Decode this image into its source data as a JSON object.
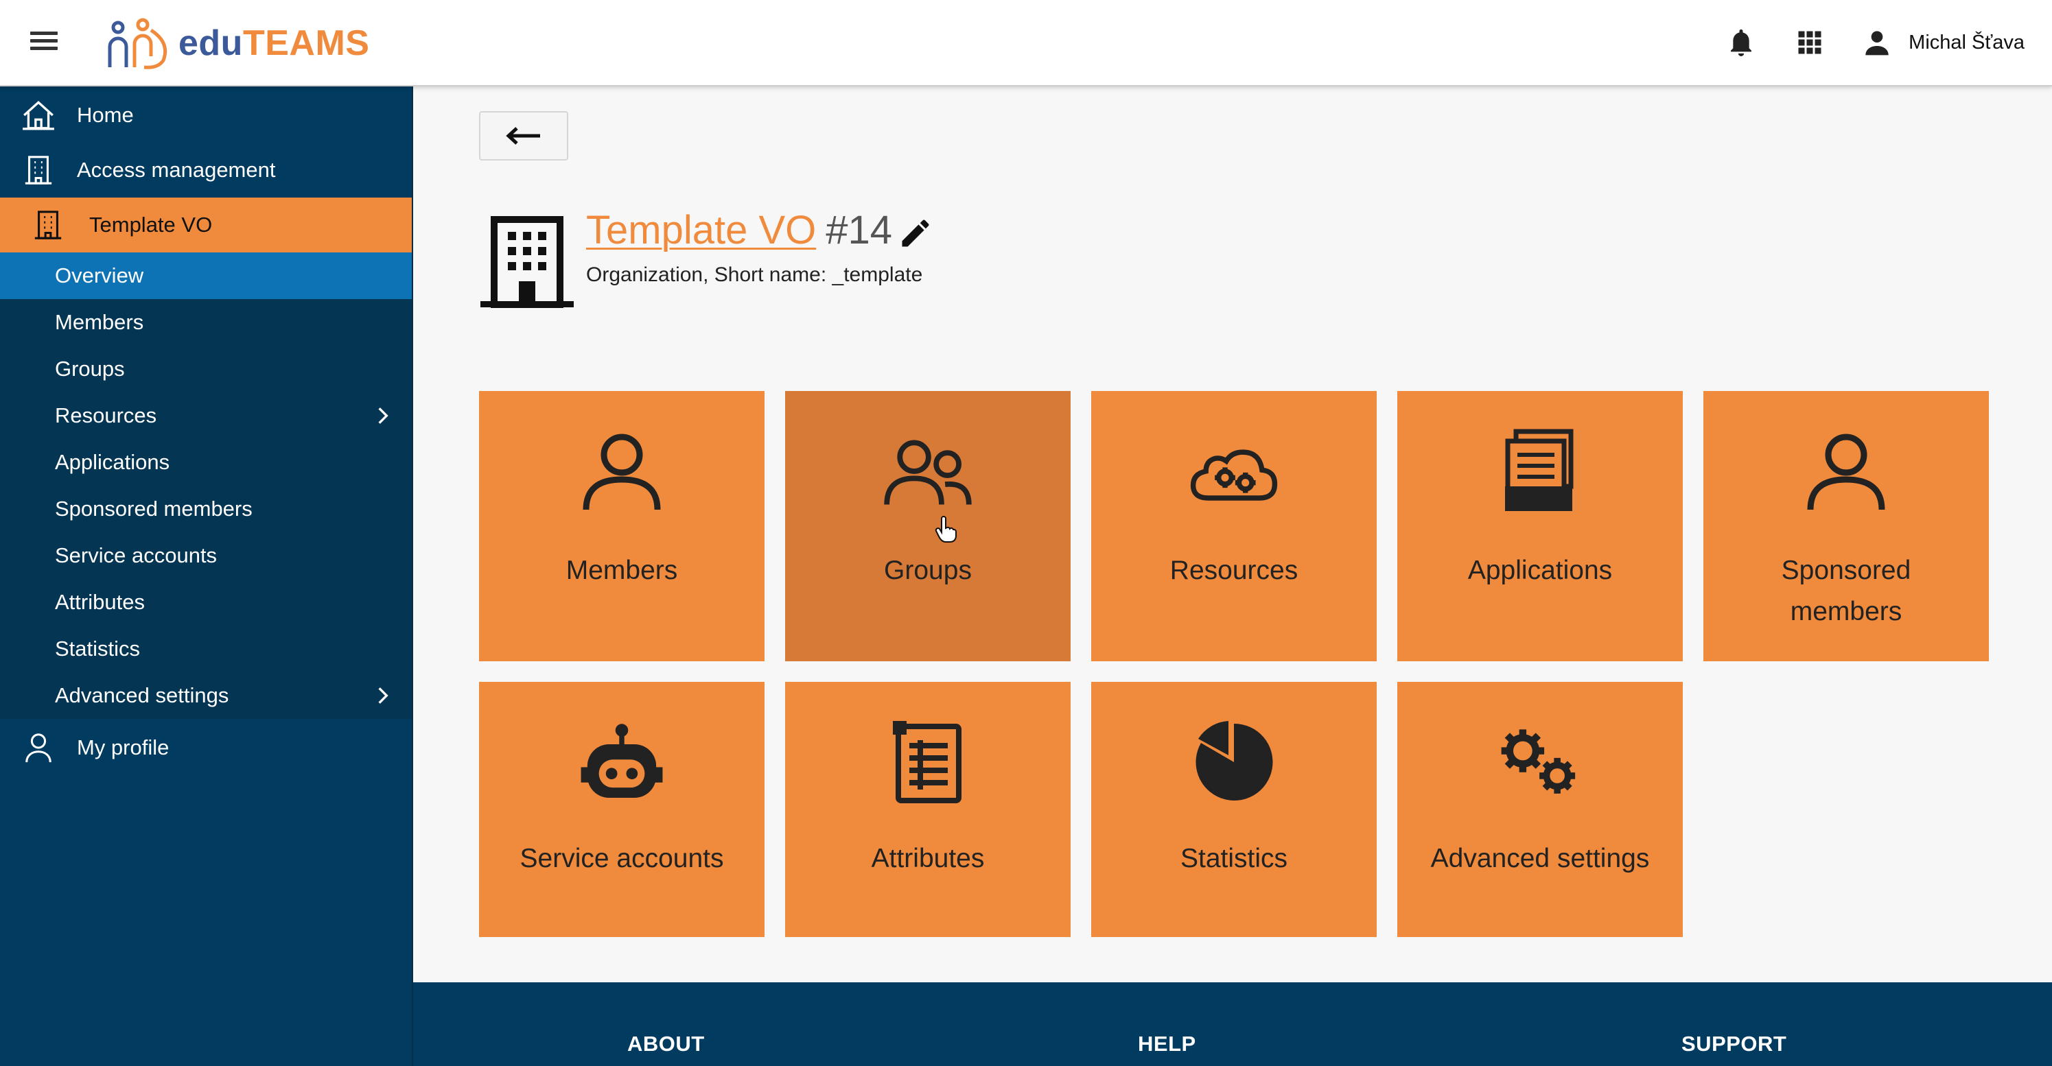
{
  "header": {
    "logo_edu": "edu",
    "logo_teams": "TEAMS",
    "user_name": "Michal Šťava"
  },
  "sidebar": {
    "home": "Home",
    "access_management": "Access management",
    "vo": "Template VO",
    "sub_items": [
      "Overview",
      "Members",
      "Groups",
      "Resources",
      "Applications",
      "Sponsored members",
      "Service accounts",
      "Attributes",
      "Statistics",
      "Advanced settings"
    ],
    "my_profile": "My profile"
  },
  "main": {
    "vo_name": "Template VO",
    "vo_id": "#14",
    "vo_subtitle": "Organization, Short name: _template",
    "tiles": [
      "Members",
      "Groups",
      "Resources",
      "Applications",
      "Sponsored members",
      "Service accounts",
      "Attributes",
      "Statistics",
      "Advanced settings"
    ]
  },
  "footer": {
    "about": "ABOUT",
    "help": "HELP",
    "support": "SUPPORT"
  },
  "colors": {
    "accent": "#f08a3c",
    "sidebar": "#013b60",
    "active": "#0e73b5"
  }
}
